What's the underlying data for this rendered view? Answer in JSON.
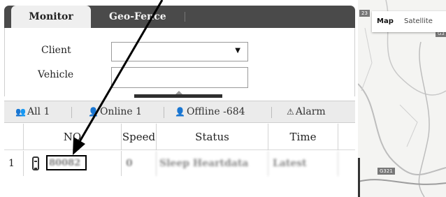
{
  "tabs": [
    {
      "label": "Monitor",
      "active": true
    },
    {
      "label": "Geo-Fence",
      "active": false
    }
  ],
  "form": {
    "client_label": "Client",
    "client_value": "",
    "vehicle_label": "Vehicle",
    "vehicle_value": ""
  },
  "filters": {
    "all": "All 1",
    "online": "Online 1",
    "offline": "Offline -684",
    "alarm": "Alarm"
  },
  "table": {
    "columns": [
      "",
      "NO",
      "Speed",
      "Status",
      "Time"
    ],
    "rows": [
      {
        "index": "1",
        "no": "80082",
        "speed": "0",
        "status": "Sleep Heartdata",
        "time": "Latest"
      }
    ]
  },
  "map": {
    "map_label": "Map",
    "satellite_label": "Satellite",
    "road_badges": [
      "23",
      "G321",
      "G3"
    ]
  },
  "icons": {
    "all": "group-icon",
    "online": "user-icon",
    "offline": "user-icon",
    "alarm": "warning-icon",
    "vehicle": "car-icon"
  },
  "colors": {
    "tab_bar": "#4a4a4a",
    "active_tab": "#efefef",
    "filter_bar": "#ebebeb",
    "highlight_box": "#000000"
  }
}
